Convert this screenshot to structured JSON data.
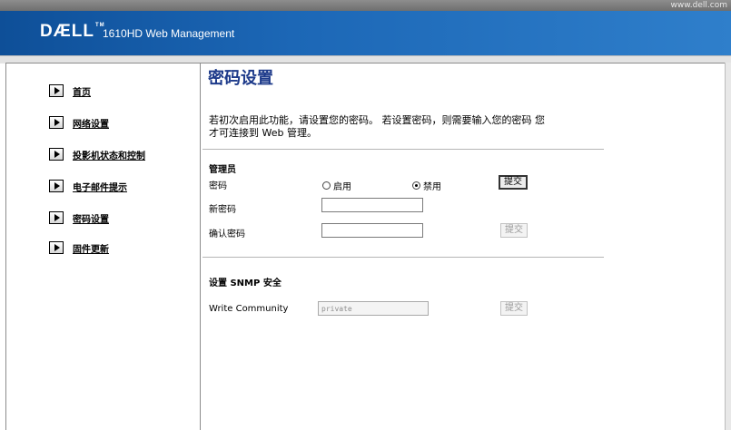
{
  "header": {
    "site_url": "www.dell.com",
    "brand_logo": "DÆLL",
    "trademark": "TM",
    "title": "1610HD Web Management"
  },
  "sidebar": {
    "items": [
      {
        "label": "首页",
        "icon": "arrow-right-icon"
      },
      {
        "label": "网络设置",
        "icon": "arrow-right-icon"
      },
      {
        "label": "投影机状态和控制",
        "icon": "arrow-right-icon"
      },
      {
        "label": "电子邮件提示",
        "icon": "arrow-right-icon"
      },
      {
        "label": "密码设置",
        "icon": "arrow-right-icon"
      },
      {
        "label": "固件更新",
        "icon": "arrow-right-icon"
      }
    ]
  },
  "main": {
    "title": "密码设置",
    "intro_line1": "若初次启用此功能，请设置您的密码。 若设置密码，则需要输入您的密码 您",
    "intro_line2": "才可连接到 Web 管理。",
    "admin": {
      "section_title": "管理员",
      "password_label": "密码",
      "enable_label": "启用",
      "disable_label": "禁用",
      "selected": "disable",
      "submit_label": "提交",
      "new_password_label": "新密码",
      "new_password_value": "",
      "confirm_password_label": "确认密码",
      "confirm_password_value": "",
      "confirm_submit_label": "提交"
    },
    "snmp": {
      "section_title": "设置 SNMP 安全",
      "write_community_label": "Write Community",
      "write_community_value": "private",
      "submit_label": "提交"
    }
  },
  "colors": {
    "banner": "#1c67b6",
    "title": "#1d3a8a"
  }
}
